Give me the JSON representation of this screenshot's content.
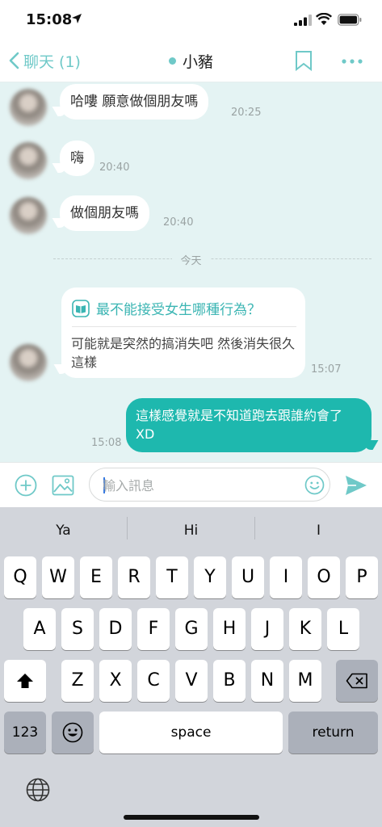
{
  "status_bar": {
    "time": "15:08"
  },
  "nav": {
    "back_label": "聊天 (1)",
    "title": "小豬",
    "accent_color": "#6fc9c8"
  },
  "messages": [
    {
      "text": "哈嘍 願意做個朋友嗎",
      "time": "20:25"
    },
    {
      "text": "嗨",
      "time": "20:40"
    },
    {
      "text": "做個朋友嗎",
      "time": "20:40"
    }
  ],
  "divider_label": "今天",
  "card": {
    "question": "最不能接受女生哪種行為？",
    "answer": "可能就是突然的搞消失吧 然後消失很久這樣",
    "time": "15:07"
  },
  "outgoing": {
    "text": "這樣感覺就是不知道跑去跟誰約會了 XD",
    "time": "15:08",
    "color": "#1eb8ae"
  },
  "input": {
    "placeholder": "輸入訊息"
  },
  "keyboard": {
    "suggestions": [
      "Ya",
      "Hi",
      "I"
    ],
    "row1": [
      "Q",
      "W",
      "E",
      "R",
      "T",
      "Y",
      "U",
      "I",
      "O",
      "P"
    ],
    "row2": [
      "A",
      "S",
      "D",
      "F",
      "G",
      "H",
      "J",
      "K",
      "L"
    ],
    "row3": [
      "Z",
      "X",
      "C",
      "V",
      "B",
      "N",
      "M"
    ],
    "numbers_label": "123",
    "space_label": "space",
    "return_label": "return"
  }
}
